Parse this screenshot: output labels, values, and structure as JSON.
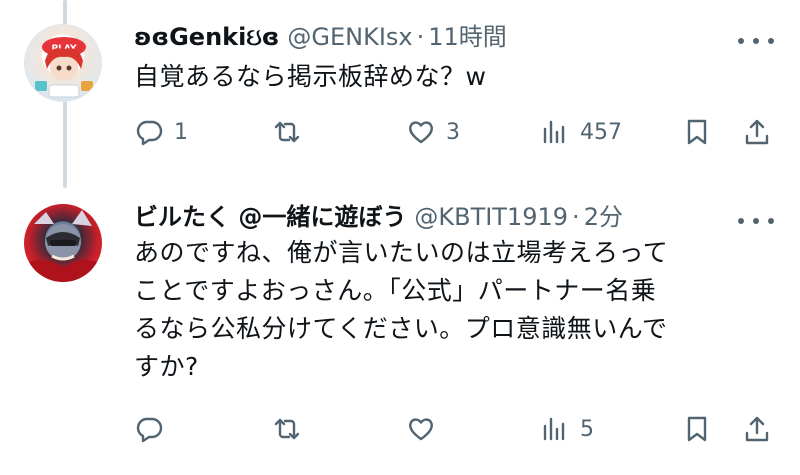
{
  "tweets": [
    {
      "display_name": "ʚɞGenkiઇɞ",
      "handle": "@GENKIsx",
      "separator": "·",
      "time": "11時間",
      "text_lines": [
        "自覚あるなら掲示板辞めな？w"
      ],
      "replies": "1",
      "retweets": "",
      "likes": "3",
      "views": "457"
    },
    {
      "display_name": "ビルたく @一緒に遊ぼう",
      "handle": "@KBTIT1919",
      "separator": "·",
      "time": "2分",
      "text_lines": [
        "あのですね、俺が言いたいのは立場考えろって",
        "ことですよおっさん。「公式」パートナー名乗",
        "るなら公私分けてください。プロ意識無いんで",
        "すか?"
      ],
      "replies": "",
      "retweets": "",
      "likes": "",
      "views": "5"
    }
  ],
  "icons": {
    "reply": "reply-bubble-icon",
    "retweet": "retweet-icon",
    "like": "heart-icon",
    "views": "views-bars-icon",
    "bookmark": "bookmark-icon",
    "share": "share-icon",
    "more": "more-dots-icon"
  },
  "colors": {
    "text_primary": "#0f1419",
    "text_secondary": "#536471",
    "thread_line": "#cfd9de"
  }
}
